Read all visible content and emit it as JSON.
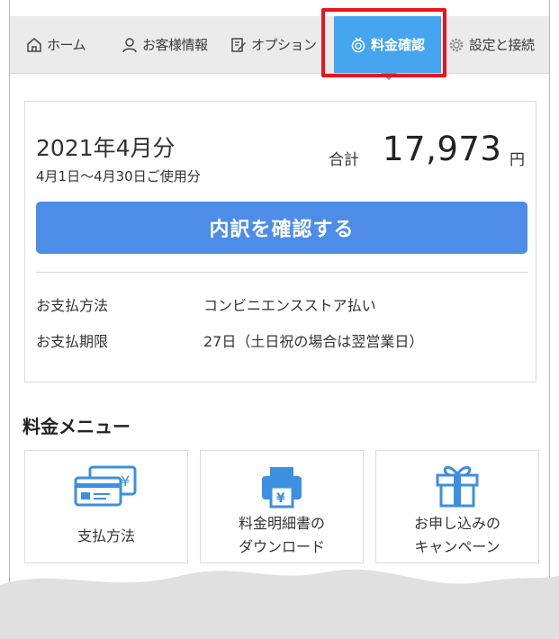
{
  "nav": {
    "items": [
      {
        "label": "ホーム",
        "icon": "home-icon"
      },
      {
        "label": "お客様情報",
        "icon": "user-icon"
      },
      {
        "label": "オプション",
        "icon": "edit-icon"
      },
      {
        "label": "料金確認",
        "icon": "coin-icon",
        "active": true
      },
      {
        "label": "設定と接続",
        "icon": "gear-icon"
      }
    ]
  },
  "billing": {
    "month": "2021年4月分",
    "period": "4月1日～4月30日ご使用分",
    "total_label": "合計",
    "total_amount": "17,973",
    "currency": "円",
    "cta_label": "内訳を確認する",
    "payment_method_label": "お支払方法",
    "payment_method_value": "コンビニエンスストア払い",
    "due_label": "お支払期限",
    "due_value": "27日（土日祝の場合は翌営業日）"
  },
  "menu": {
    "title": "料金メニュー",
    "tiles": [
      {
        "label": "支払方法",
        "icon": "payment-cards-icon"
      },
      {
        "label": "料金明細書の\nダウンロード",
        "icon": "printer-yen-icon"
      },
      {
        "label": "お申し込みの\nキャンペーン",
        "icon": "gift-icon"
      }
    ]
  },
  "colors": {
    "accent": "#45a5ee",
    "button": "#4d8de8",
    "highlight": "#e8141e",
    "nav_bg": "#ebebeb"
  }
}
